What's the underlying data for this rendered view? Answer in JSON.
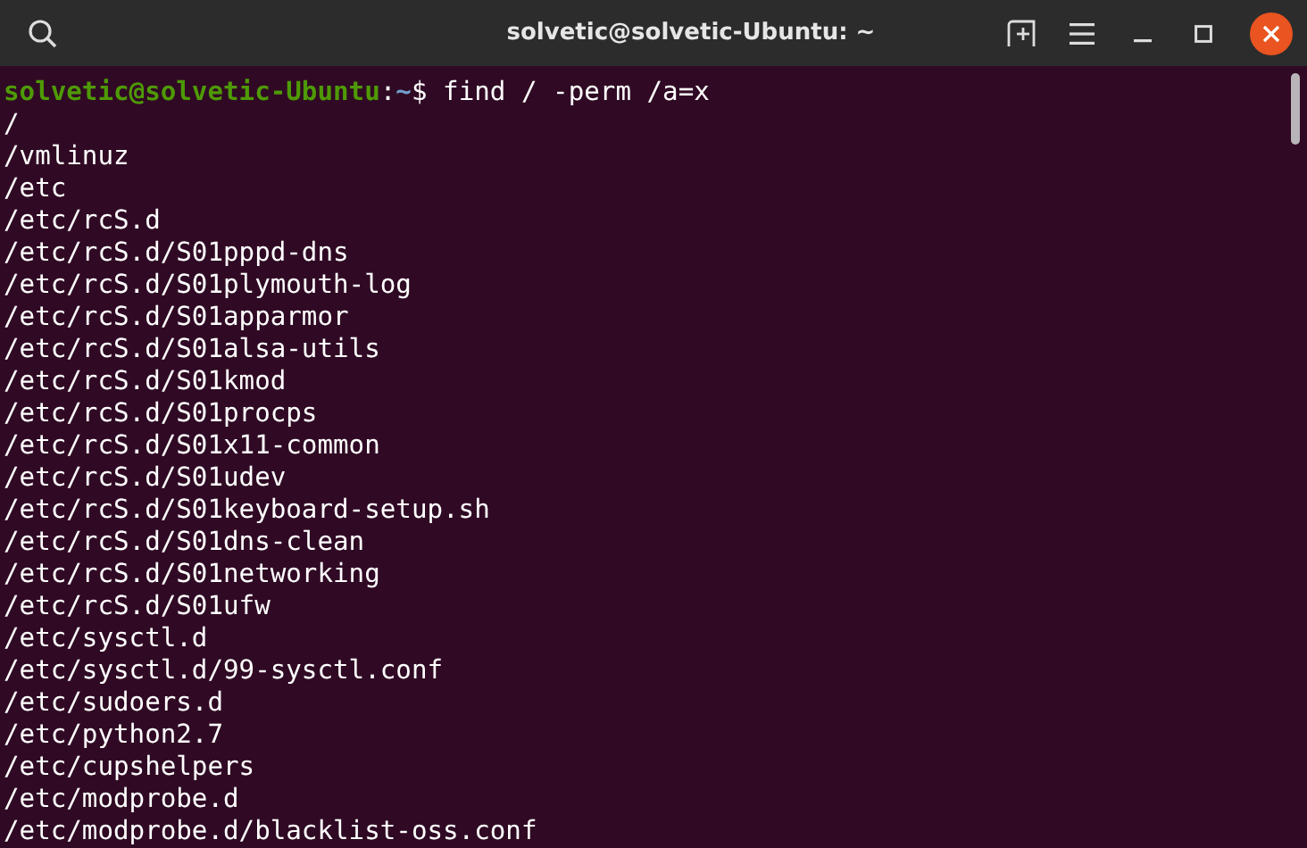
{
  "window": {
    "title": "solvetic@solvetic-Ubuntu: ~"
  },
  "prompt": {
    "user_host": "solvetic@solvetic-Ubuntu",
    "separator": ":",
    "cwd": "~",
    "command": "$ find / -perm /a=x"
  },
  "output": [
    "/",
    "/vmlinuz",
    "/etc",
    "/etc/rcS.d",
    "/etc/rcS.d/S01pppd-dns",
    "/etc/rcS.d/S01plymouth-log",
    "/etc/rcS.d/S01apparmor",
    "/etc/rcS.d/S01alsa-utils",
    "/etc/rcS.d/S01kmod",
    "/etc/rcS.d/S01procps",
    "/etc/rcS.d/S01x11-common",
    "/etc/rcS.d/S01udev",
    "/etc/rcS.d/S01keyboard-setup.sh",
    "/etc/rcS.d/S01dns-clean",
    "/etc/rcS.d/S01networking",
    "/etc/rcS.d/S01ufw",
    "/etc/sysctl.d",
    "/etc/sysctl.d/99-sysctl.conf",
    "/etc/sudoers.d",
    "/etc/python2.7",
    "/etc/cupshelpers",
    "/etc/modprobe.d",
    "/etc/modprobe.d/blacklist-oss.conf"
  ]
}
